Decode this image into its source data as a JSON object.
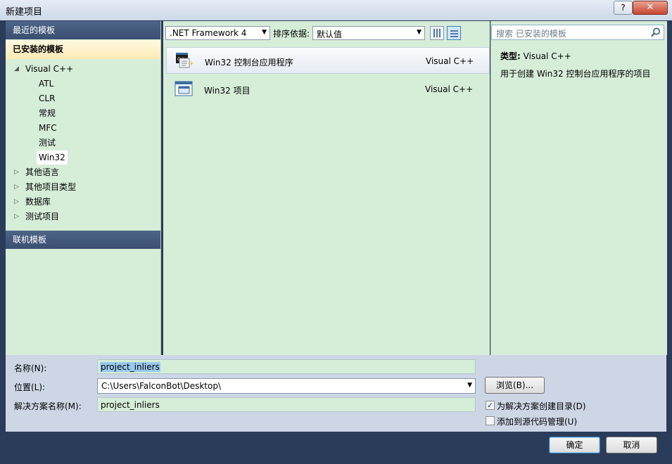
{
  "window": {
    "title": "新建项目",
    "help_label": "?",
    "close_label": "✕"
  },
  "left": {
    "recent_header": "最近的模板",
    "installed_header": "已安装的模板",
    "online_header": "联机模板",
    "tree": [
      {
        "label": "Visual C++",
        "arrow": "◢",
        "level": 0
      },
      {
        "label": "ATL",
        "arrow": "",
        "level": 1
      },
      {
        "label": "CLR",
        "arrow": "",
        "level": 1
      },
      {
        "label": "常规",
        "arrow": "",
        "level": 1
      },
      {
        "label": "MFC",
        "arrow": "",
        "level": 1
      },
      {
        "label": "测试",
        "arrow": "",
        "level": 1
      },
      {
        "label": "Win32",
        "arrow": "",
        "level": 1,
        "selected": true
      },
      {
        "label": "其他语言",
        "arrow": "▷",
        "level": 0
      },
      {
        "label": "其他项目类型",
        "arrow": "▷",
        "level": 0
      },
      {
        "label": "数据库",
        "arrow": "▷",
        "level": 0
      },
      {
        "label": "测试项目",
        "arrow": "▷",
        "level": 0
      }
    ]
  },
  "toolbar": {
    "framework": ".NET Framework 4",
    "sort_label": "排序依据:",
    "sort_value": "默认值"
  },
  "projects": [
    {
      "name": "Win32 控制台应用程序",
      "lang": "Visual C++",
      "icon": "console-app-icon",
      "selected": true
    },
    {
      "name": "Win32 项目",
      "lang": "Visual C++",
      "icon": "win32-window-icon",
      "selected": false
    }
  ],
  "details": {
    "search_placeholder": "搜索 已安装的模板",
    "type_label": "类型:",
    "type_value": "Visual C++",
    "description": "用于创建 Win32 控制台应用程序的项目"
  },
  "form": {
    "name_label": "名称(N):",
    "name_value": "project_inliers",
    "location_label": "位置(L):",
    "location_value": "C:\\Users\\FalconBot\\Desktop\\",
    "solution_label": "解决方案名称(M):",
    "solution_value": "project_inliers",
    "browse_label": "浏览(B)...",
    "create_dir_label": "为解决方案创建目录(D)",
    "create_dir_checked": true,
    "source_control_label": "添加到源代码管理(U)",
    "source_control_checked": false
  },
  "buttons": {
    "ok": "确定",
    "cancel": "取消"
  }
}
